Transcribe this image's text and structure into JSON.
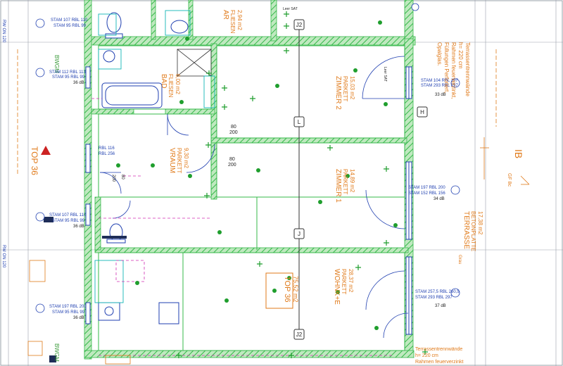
{
  "colors": {
    "wall_green": "#35b84a",
    "wall_fill": "#9fe0a0",
    "blue": "#1f3fb0",
    "orange": "#e07a1a",
    "red": "#cc2222",
    "cyan": "#12b5b5",
    "magenta": "#d12fb4",
    "dot_green": "#1f9e2d"
  },
  "rooms": {
    "ar": {
      "name": "AR",
      "floor": "FLIESEN",
      "area": "2,94 m2"
    },
    "bad": {
      "name": "BAD",
      "floor": "FLIESEN",
      "area": "6,00 m2"
    },
    "vraum": {
      "name": "VRAUM",
      "floor": "PARKETT",
      "area": "9,30 m2"
    },
    "zimmer2": {
      "name": "ZIMMER 2",
      "floor": "PARKETT",
      "area": "15,03 m2"
    },
    "zimmer1": {
      "name": "ZIMMER 1",
      "floor": "PARKETT",
      "area": "14,89 m2"
    },
    "wohnen": {
      "name": "WOHNK+E",
      "floor": "PARKETT",
      "area": "28,37 m2"
    },
    "terrasse": {
      "name": "TERRASSE",
      "floor": "BETONPLATTE",
      "area": "17,38 m2"
    },
    "top_box": {
      "name": "TOP 36",
      "area": "75,52 m2"
    }
  },
  "stamps": {
    "s1": {
      "line1": "STAM 107 RBL 110",
      "line2": "STAM 95 RBL 99"
    },
    "s2": {
      "line1": "STAM 112 RBL 113",
      "line2": "STAM 95 RBL 99",
      "db": "36 dB"
    },
    "s3": {
      "line1": "STAM 107 RBL 110",
      "line2": "STAM 95 RBL 99",
      "db": "36 dB"
    },
    "s4": {
      "line1": "STAM 197 RBL 200",
      "line2": "STAM 95 RBL 99",
      "db": "36 dB"
    },
    "s5": {
      "line1": "STAM 104 RBL 107",
      "line2": "STAM 293 RBL 297",
      "db": "33 dB"
    },
    "s6": {
      "line1": "STAM 197 RBL 200",
      "line2": "STAM 152 RBL 156",
      "db": "34 dB"
    },
    "s7": {
      "line1": "STAM 257,5 RBL 260,5",
      "line2": "STAM 293 RBL 297",
      "db": "37 dB"
    }
  },
  "texts": {
    "top36": "TOP 36",
    "bwgm_1": "BWGM",
    "bwgm_2": "BWGM",
    "rw_top": "RW ON 120",
    "rw_bottom": "RW ON 120",
    "terrasse_note_1": "Terrassentrennwände",
    "terrasse_note_2": "h= 220 cm",
    "terrasse_note_3": "Rahmen feuerverzinkt,",
    "terrasse_note_4": "Füllungen Perforiert,",
    "terrasse_note_5": "Opalglas.",
    "terrasse_bottom_1": "Terrassentrennwände",
    "terrasse_bottom_2": "h= 220 cm",
    "terrasse_bottom_3": "Rahmen feuerverzinkt",
    "ib": "IB",
    "grundstufe": "GF 8c",
    "axis_h": "H",
    "axis_j": "J",
    "axis_l": "L",
    "axis_j2_top": "J2",
    "axis_j2_bottom": "J2",
    "door_80_1": "80",
    "door_200_1": "200",
    "door_80_2": "80",
    "door_200_2": "200",
    "door_80_3": "80",
    "door_200_3": "200",
    "db_small": "36 dB",
    "c36": "36 dB",
    "c34": "34 dB",
    "c33": "33 dB",
    "c37": "37 dB",
    "sat_1": "Leer SAT",
    "sat_2": "Leer SAT",
    "rbl": "RBL 116",
    "rbl2": "RBL 256",
    "grau": "Grau"
  }
}
